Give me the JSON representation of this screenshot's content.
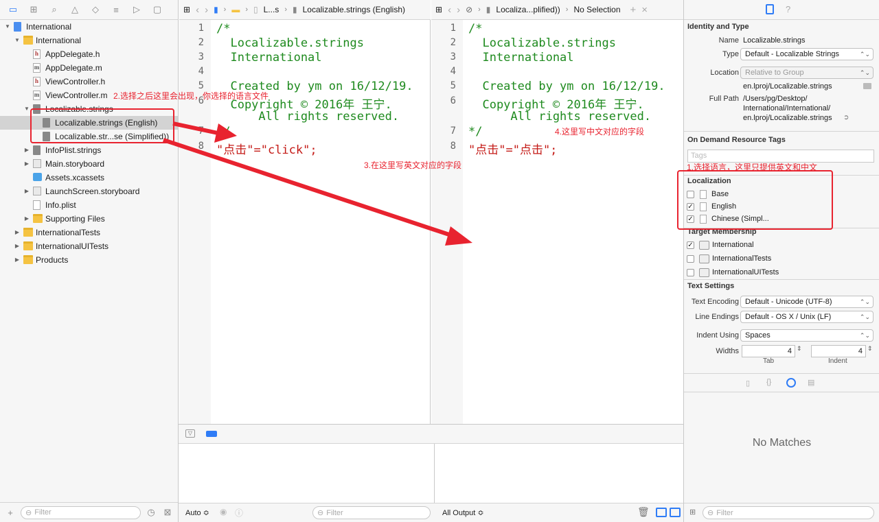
{
  "navigator": {
    "tree": [
      {
        "label": "International",
        "type": "proj",
        "depth": 0,
        "disclosure": "open"
      },
      {
        "label": "International",
        "type": "folder",
        "depth": 1,
        "disclosure": "open"
      },
      {
        "label": "AppDelegate.h",
        "type": "hfile",
        "depth": 2
      },
      {
        "label": "AppDelegate.m",
        "type": "mfile",
        "depth": 2
      },
      {
        "label": "ViewController.h",
        "type": "hfile",
        "depth": 2
      },
      {
        "label": "ViewController.m",
        "type": "mfile",
        "depth": 2
      },
      {
        "label": "Localizable.strings",
        "type": "strings",
        "depth": 2,
        "disclosure": "open"
      },
      {
        "label": "Localizable.strings (English)",
        "type": "strings",
        "depth": 3,
        "selected": true
      },
      {
        "label": "Localizable.str...se (Simplified))",
        "type": "strings",
        "depth": 3
      },
      {
        "label": "InfoPlist.strings",
        "type": "strings",
        "depth": 2,
        "disclosure": "closed"
      },
      {
        "label": "Main.storyboard",
        "type": "board",
        "depth": 2,
        "disclosure": "closed"
      },
      {
        "label": "Assets.xcassets",
        "type": "assets",
        "depth": 2
      },
      {
        "label": "LaunchScreen.storyboard",
        "type": "board",
        "depth": 2,
        "disclosure": "closed"
      },
      {
        "label": "Info.plist",
        "type": "plain",
        "depth": 2
      },
      {
        "label": "Supporting Files",
        "type": "folder",
        "depth": 2,
        "disclosure": "closed"
      },
      {
        "label": "InternationalTests",
        "type": "folder",
        "depth": 1,
        "disclosure": "closed"
      },
      {
        "label": "InternationalUITests",
        "type": "folder",
        "depth": 1,
        "disclosure": "closed"
      },
      {
        "label": "Products",
        "type": "folder",
        "depth": 1,
        "disclosure": "closed"
      }
    ],
    "filter_placeholder": "Filter"
  },
  "editor_left": {
    "jumpbar": {
      "crumb1": "L...s",
      "crumb2": "Localizable.strings (English)"
    },
    "lines": [
      {
        "n": "1",
        "text": "/*",
        "kind": "c"
      },
      {
        "n": "2",
        "text": "  Localizable.strings",
        "kind": "c"
      },
      {
        "n": "3",
        "text": "  International",
        "kind": "c"
      },
      {
        "n": "4",
        "text": "",
        "kind": "c"
      },
      {
        "n": "5",
        "text": "  Created by ym on 16/12/19.",
        "kind": "c"
      },
      {
        "n": "6",
        "text": "  Copyright © 2016年 王宁.",
        "kind": "c"
      },
      {
        "n": "",
        "text": "      All rights reserved.",
        "kind": "c"
      },
      {
        "n": "7",
        "text": "*/",
        "kind": "c"
      },
      {
        "n": "8",
        "text": "\"点击\"=\"click\";",
        "kind": "s"
      }
    ]
  },
  "editor_right": {
    "jumpbar": {
      "crumb1": "Localiza...plified))",
      "crumb2": "No Selection"
    },
    "lines": [
      {
        "n": "1",
        "text": "/*",
        "kind": "c"
      },
      {
        "n": "2",
        "text": "  Localizable.strings",
        "kind": "c"
      },
      {
        "n": "3",
        "text": "  International",
        "kind": "c"
      },
      {
        "n": "4",
        "text": "",
        "kind": "c"
      },
      {
        "n": "5",
        "text": "  Created by ym on 16/12/19.",
        "kind": "c"
      },
      {
        "n": "6",
        "text": "  Copyright © 2016年 王宁.",
        "kind": "c"
      },
      {
        "n": "",
        "text": "      All rights reserved.",
        "kind": "c"
      },
      {
        "n": "7",
        "text": "*/",
        "kind": "c"
      },
      {
        "n": "8",
        "text": "\"点击\"=\"点击\";",
        "kind": "s"
      }
    ]
  },
  "debug": {
    "auto_label": "Auto ≎",
    "filter_placeholder": "Filter",
    "output_label": "All Output ≎"
  },
  "inspector": {
    "identity_title": "Identity and Type",
    "name_label": "Name",
    "name_value": "Localizable.strings",
    "type_label": "Type",
    "type_value": "Default - Localizable Strings",
    "location_label": "Location",
    "location_value": "Relative to Group",
    "location_path": "en.lproj/Localizable.strings",
    "fullpath_label": "Full Path",
    "fullpath_lines": [
      "/Users/pg/Desktop/",
      "International/International/",
      "en.lproj/Localizable.strings"
    ],
    "odr_title": "On Demand Resource Tags",
    "tags_placeholder": "Tags",
    "localization_title": "Localization",
    "localizations": [
      {
        "label": "Base",
        "checked": false
      },
      {
        "label": "English",
        "checked": true
      },
      {
        "label": "Chinese (Simpl...",
        "checked": true
      }
    ],
    "target_title": "Target Membership",
    "targets": [
      {
        "label": "International",
        "checked": true
      },
      {
        "label": "InternationalTests",
        "checked": false
      },
      {
        "label": "InternationalUITests",
        "checked": false
      }
    ],
    "text_title": "Text Settings",
    "encoding_label": "Text Encoding",
    "encoding_value": "Default - Unicode (UTF-8)",
    "endings_label": "Line Endings",
    "endings_value": "Default - OS X / Unix (LF)",
    "indent_label": "Indent Using",
    "indent_value": "Spaces",
    "widths_label": "Widths",
    "tab_value": "4",
    "indent_width_value": "4",
    "tab_caption": "Tab",
    "indent_caption": "Indent",
    "library_empty": "No Matches",
    "filter_placeholder": "Filter"
  },
  "annotations": {
    "a1": "1.选择语言，这里只提供英文和中文",
    "a2": "2.选择之后这里会出现，你选择的语言文件",
    "a3": "3.在这里写英文对应的字段",
    "a4": "4.这里写中文对应的字段",
    "color": "#e8232f"
  }
}
